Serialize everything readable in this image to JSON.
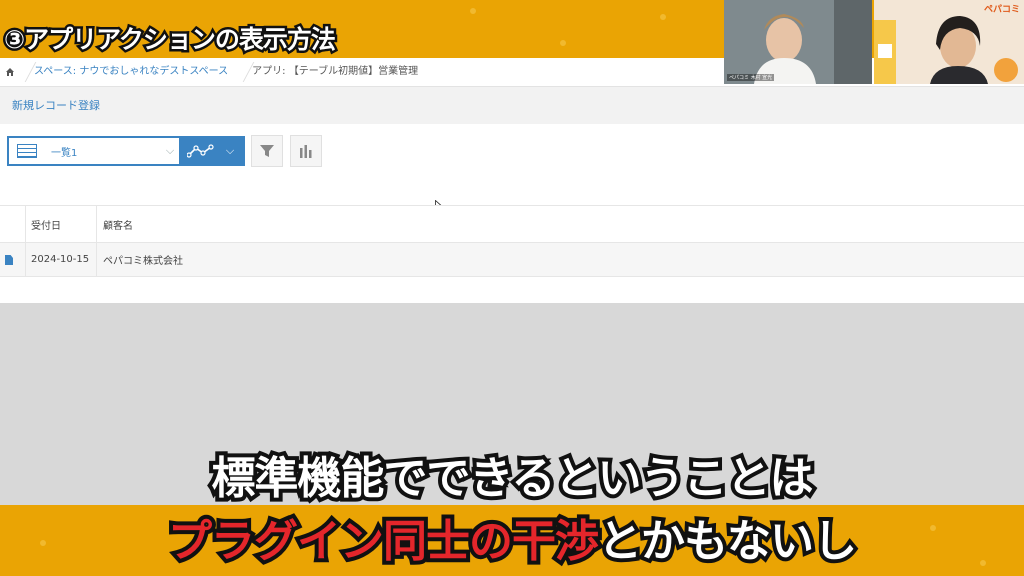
{
  "overlay": {
    "title": "③アプリアクションの表示方法",
    "subtitle_line1": "標準機能でできるということは",
    "subtitle_line2_red": "プラグイン同士の干渉",
    "subtitle_line2_white": "とかもないし",
    "brand_logo": "ペパコミ",
    "cam1_label": "ペパコミ 木村 宣光"
  },
  "breadcrumb": {
    "space": "スペース: ナウでおしゃれなデストスペース",
    "app": "アプリ: 【テーブル初期値】営業管理"
  },
  "header": {
    "new_record": "新規レコード登録"
  },
  "toolbar": {
    "view_label": "一覧1",
    "view_icon": "table-list-icon",
    "graph_icon": "line-graph-icon",
    "filter_icon": "filter-icon",
    "chart_icon": "bar-chart-icon"
  },
  "table": {
    "columns": [
      "受付日",
      "顧客名"
    ],
    "rows": [
      {
        "date": "2024-10-15",
        "customer": "ペパコミ株式会社"
      }
    ]
  },
  "colors": {
    "accent": "#3a83c2",
    "band": "#eaa404",
    "subtitle_red": "#e4262b"
  }
}
